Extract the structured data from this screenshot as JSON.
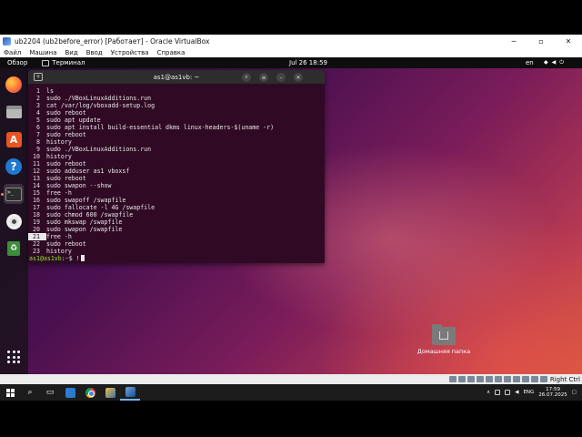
{
  "vbox": {
    "title": "ub2204 (ub2before_error) [Работает] - Oracle VirtualBox",
    "menu": [
      "Файл",
      "Машина",
      "Вид",
      "Ввод",
      "Устройства",
      "Справка"
    ],
    "host_key": "Right Ctrl"
  },
  "gnome": {
    "activities": "Обзор",
    "app_name": "Терминал",
    "clock": "Jul 26  18:59",
    "lang": "en"
  },
  "dock": [
    "firefox-icon",
    "files-icon",
    "app-store-icon",
    "help-icon",
    "terminal-icon",
    "cd-icon",
    "trash-icon",
    "app-grid-icon"
  ],
  "terminal": {
    "title": "as1@as1vb: ~",
    "history": [
      {
        "n": "1",
        "cmd": "ls"
      },
      {
        "n": "2",
        "cmd": "sudo ./VBoxLinuxAdditions.run"
      },
      {
        "n": "3",
        "cmd": "cat /var/log/vboxadd-setup.log"
      },
      {
        "n": "4",
        "cmd": "sudo reboot"
      },
      {
        "n": "5",
        "cmd": "sudo apt update"
      },
      {
        "n": "6",
        "cmd": "sudo apt install build-essential dkms linux-headers-$(uname -r)"
      },
      {
        "n": "7",
        "cmd": "sudo reboot"
      },
      {
        "n": "8",
        "cmd": "history"
      },
      {
        "n": "9",
        "cmd": "sudo ./VBoxLinuxAdditions.run"
      },
      {
        "n": "10",
        "cmd": "history"
      },
      {
        "n": "11",
        "cmd": "sudo reboot"
      },
      {
        "n": "12",
        "cmd": "sudo adduser as1 vboxsf"
      },
      {
        "n": "13",
        "cmd": "sudo reboot"
      },
      {
        "n": "14",
        "cmd": "sudo swapon --show"
      },
      {
        "n": "15",
        "cmd": "free -h"
      },
      {
        "n": "16",
        "cmd": "sudo swapoff /swapfile"
      },
      {
        "n": "17",
        "cmd": "sudo fallocate -l 4G /swapfile"
      },
      {
        "n": "18",
        "cmd": "sudo chmod 600 /swapfile"
      },
      {
        "n": "19",
        "cmd": "sudo mkswap /swapfile"
      },
      {
        "n": "20",
        "cmd": "sudo swapon /swapfile"
      },
      {
        "n": "21",
        "cmd": "free -h",
        "highlight": true
      },
      {
        "n": "22",
        "cmd": "sudo reboot"
      },
      {
        "n": "23",
        "cmd": "history"
      }
    ],
    "prompt_user": "as1@as1vb",
    "prompt_sep": ":",
    "prompt_path": "~",
    "prompt_symbol": "$ ",
    "input": "!"
  },
  "desktop": {
    "home_label": "Домашняя папка"
  },
  "windows": {
    "lang": "ENG",
    "time": "17:59",
    "date": "26.07.2025"
  }
}
